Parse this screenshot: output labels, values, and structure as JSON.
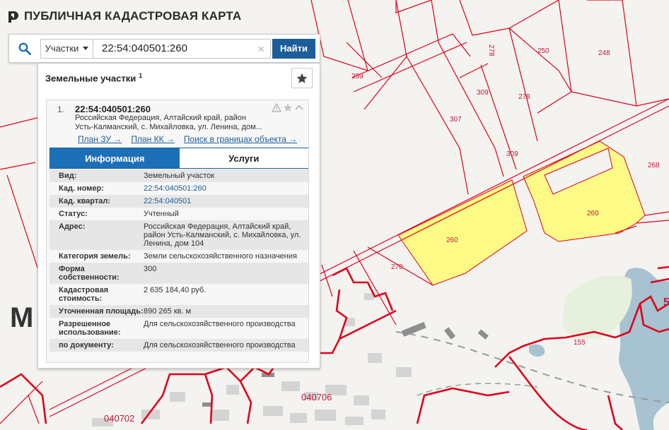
{
  "header": {
    "title": "ПУБЛИЧНАЯ КАДАСТРОВАЯ КАРТА",
    "logo_icon": "cadastre-logo-icon"
  },
  "search": {
    "type_selected": "Участки",
    "query": "22:54:040501:260",
    "find_label": "Найти"
  },
  "panel": {
    "title": "Земельные участки",
    "count": "1",
    "favorite_icon": "star-icon"
  },
  "result": {
    "index": "1.",
    "cadastral_number": "22:54:040501:260",
    "address_line1": "Российская Федерация, Алтайский край, район",
    "address_line2": "Усть-Калманский, с. Михайловка, ул. Ленина, дом...",
    "links": [
      {
        "label": "План ЗУ →"
      },
      {
        "label": "План КК →"
      },
      {
        "label": "Поиск в границах объекта →"
      }
    ],
    "tabs": [
      {
        "label": "Информация",
        "active": true
      },
      {
        "label": "Услуги",
        "active": false
      }
    ],
    "properties": [
      {
        "label": "Вид:",
        "value": "Земельный участок"
      },
      {
        "label": "Кад. номер:",
        "value": "22:54:040501:260"
      },
      {
        "label": "Кад. квартал:",
        "value": "22:54:040501"
      },
      {
        "label": "Статус:",
        "value": "Учтенный"
      },
      {
        "label": "Адрес:",
        "value": "Российская Федерация, Алтайский край, район Усть-Калманский, с. Михайловка, ул. Ленина, дом 104"
      },
      {
        "label": "Категория земель:",
        "value": "Земли сельскохозяйственного назначения"
      },
      {
        "label": "Форма собственности:",
        "value": "300"
      },
      {
        "label": "Кадастровая стоимость:",
        "value": "2 635 184,40 руб."
      },
      {
        "label": "Уточненная площадь:",
        "value": "890 265 кв. м"
      },
      {
        "label": "Разрешенное использование:",
        "value": "Для сельскохозяйственного производства"
      },
      {
        "label": "по документу:",
        "value": "Для сельскохозяйственного производства"
      }
    ]
  },
  "map": {
    "parcel_labels": [
      "259",
      "278",
      "250",
      "248",
      "307",
      "309",
      "278",
      "309",
      "268",
      "260",
      "260",
      "270",
      "155"
    ],
    "quarter_labels": [
      "040706",
      "040702"
    ],
    "place_letter": "М",
    "edge_digit": "5",
    "colors": {
      "boundary": "#e2001a",
      "selected_fill": "#fdfb86",
      "water": "#a7c2d1",
      "park": "#e6f0dc",
      "buildings": "#d4d4d4"
    }
  }
}
